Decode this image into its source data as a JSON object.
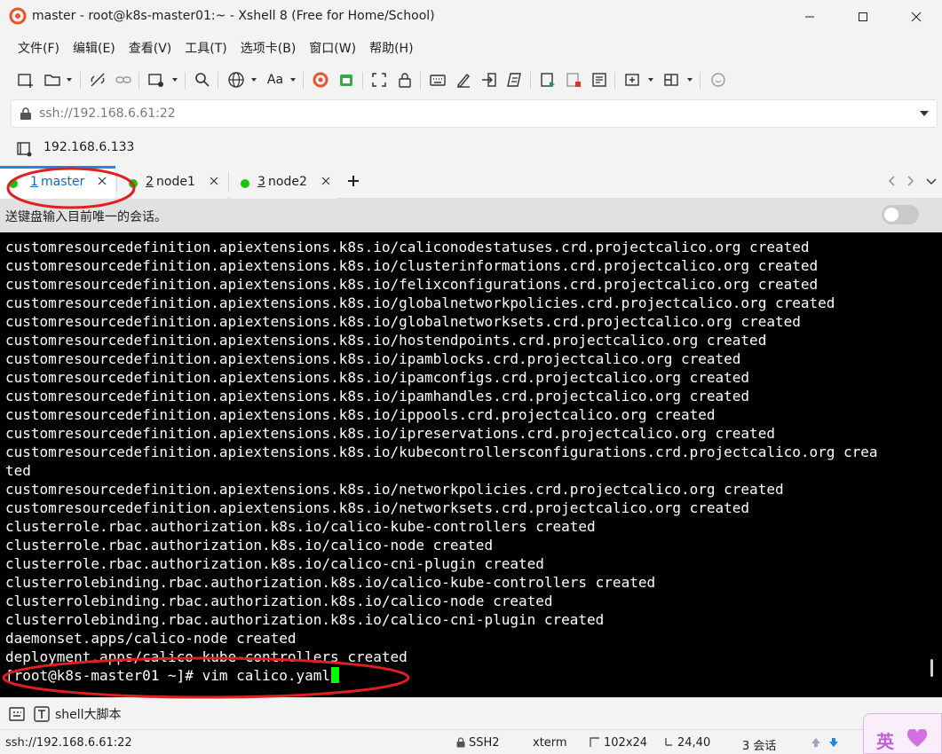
{
  "window": {
    "title": "master - root@k8s-master01:~ - Xshell 8 (Free for Home/School)",
    "app_icon": "xshell-logo-icon",
    "controls": [
      "minimize-icon",
      "maximize-icon",
      "close-icon"
    ]
  },
  "menu": {
    "items": [
      {
        "label": "文件(F)"
      },
      {
        "label": "编辑(E)"
      },
      {
        "label": "查看(V)"
      },
      {
        "label": "工具(T)"
      },
      {
        "label": "选项卡(B)"
      },
      {
        "label": "窗口(W)"
      },
      {
        "label": "帮助(H)"
      }
    ]
  },
  "toolbar": {
    "font_button_label": "Aa"
  },
  "address": {
    "value": "ssh://192.168.6.61:22"
  },
  "host": {
    "value": "192.168.6.133"
  },
  "tabs": [
    {
      "number": "1",
      "name": "master",
      "active": true
    },
    {
      "number": "2",
      "name": "node1",
      "active": false
    },
    {
      "number": "3",
      "name": "node2",
      "active": false
    }
  ],
  "send_bar": {
    "text": "送键盘输入目前唯一的会话。",
    "toggle_on": false
  },
  "terminal": {
    "lines": [
      "customresourcedefinition.apiextensions.k8s.io/caliconodestatuses.crd.projectcalico.org created",
      "customresourcedefinition.apiextensions.k8s.io/clusterinformations.crd.projectcalico.org created",
      "customresourcedefinition.apiextensions.k8s.io/felixconfigurations.crd.projectcalico.org created",
      "customresourcedefinition.apiextensions.k8s.io/globalnetworkpolicies.crd.projectcalico.org created",
      "customresourcedefinition.apiextensions.k8s.io/globalnetworksets.crd.projectcalico.org created",
      "customresourcedefinition.apiextensions.k8s.io/hostendpoints.crd.projectcalico.org created",
      "customresourcedefinition.apiextensions.k8s.io/ipamblocks.crd.projectcalico.org created",
      "customresourcedefinition.apiextensions.k8s.io/ipamconfigs.crd.projectcalico.org created",
      "customresourcedefinition.apiextensions.k8s.io/ipamhandles.crd.projectcalico.org created",
      "customresourcedefinition.apiextensions.k8s.io/ippools.crd.projectcalico.org created",
      "customresourcedefinition.apiextensions.k8s.io/ipreservations.crd.projectcalico.org created",
      "customresourcedefinition.apiextensions.k8s.io/kubecontrollersconfigurations.crd.projectcalico.org crea",
      "ted",
      "customresourcedefinition.apiextensions.k8s.io/networkpolicies.crd.projectcalico.org created",
      "customresourcedefinition.apiextensions.k8s.io/networksets.crd.projectcalico.org created",
      "clusterrole.rbac.authorization.k8s.io/calico-kube-controllers created",
      "clusterrole.rbac.authorization.k8s.io/calico-node created",
      "clusterrole.rbac.authorization.k8s.io/calico-cni-plugin created",
      "clusterrolebinding.rbac.authorization.k8s.io/calico-kube-controllers created",
      "clusterrolebinding.rbac.authorization.k8s.io/calico-node created",
      "clusterrolebinding.rbac.authorization.k8s.io/calico-cni-plugin created",
      "daemonset.apps/calico-node created",
      "deployment.apps/calico-kube-controllers created"
    ],
    "prompt": "[root@k8s-master01 ~]# ",
    "command": "vim calico.yaml",
    "cursor_color": "#00ff00",
    "background": "#000000",
    "foreground": "#ffffff"
  },
  "quickbar": {
    "label": "shell大脚本"
  },
  "status": {
    "connection": "ssh://192.168.6.61:22",
    "protocol": "SSH2",
    "terminal_type": "xterm",
    "size": "102x24",
    "cursor_pos": "24,40",
    "sessions": "3 会话"
  },
  "ime": {
    "label": "英"
  },
  "colors": {
    "annotation_red": "#e02020",
    "active_tab_accent": "#1e88e5",
    "session_dot_green": "#16c60c"
  }
}
